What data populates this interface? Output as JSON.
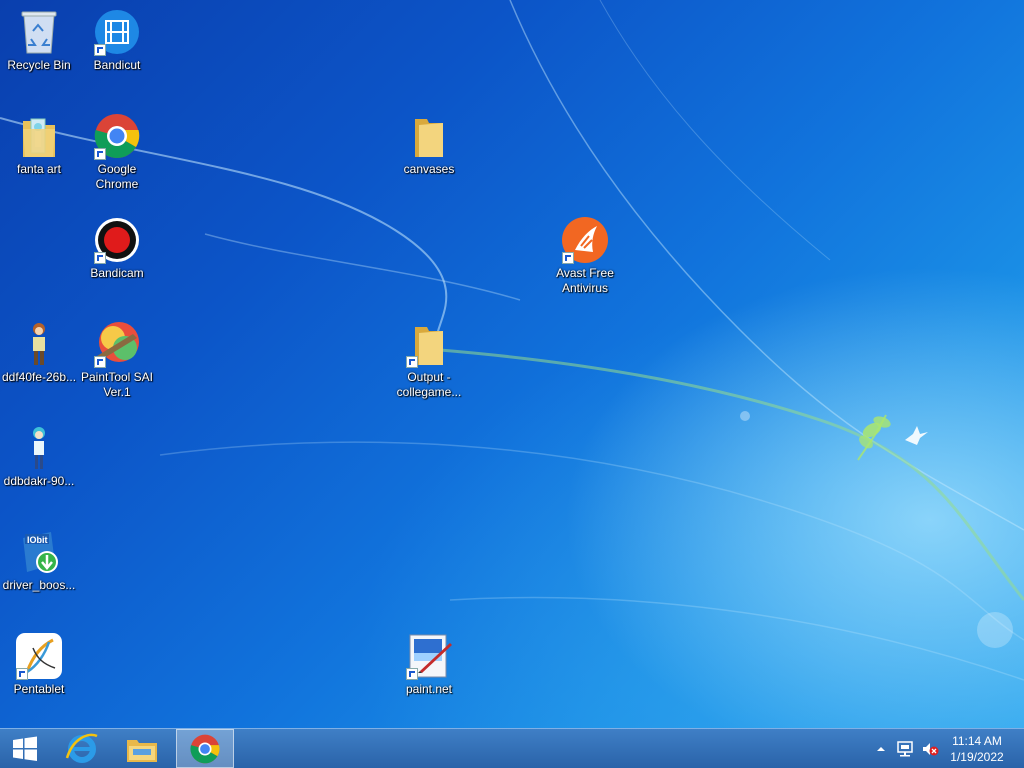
{
  "desktop": {
    "icons": [
      {
        "id": "recycle-bin",
        "label": "Recycle Bin",
        "icon": "recycle-bin-icon"
      },
      {
        "id": "bandicut",
        "label": "Bandicut",
        "icon": "film-icon"
      },
      {
        "id": "fanta-art",
        "label": "fanta art",
        "icon": "folder-icon"
      },
      {
        "id": "google-chrome",
        "label": "Google Chrome",
        "icon": "chrome-icon"
      },
      {
        "id": "canvases",
        "label": "canvases",
        "icon": "folder-icon"
      },
      {
        "id": "bandicam",
        "label": "Bandicam",
        "icon": "record-icon"
      },
      {
        "id": "avast",
        "label": "Avast Free Antivirus",
        "icon": "avast-icon"
      },
      {
        "id": "ddf40fe",
        "label": "ddf40fe-26b...",
        "icon": "character-image-icon"
      },
      {
        "id": "painttool-sai",
        "label": "PaintTool SAI Ver.1",
        "icon": "painttool-sai-icon"
      },
      {
        "id": "output-collegame",
        "label": "Output - collegame...",
        "icon": "folder-icon"
      },
      {
        "id": "ddbdakr",
        "label": "ddbdakr-90...",
        "icon": "character-image-icon"
      },
      {
        "id": "driver-booster",
        "label": "driver_boos...",
        "icon": "iobit-installer-icon"
      },
      {
        "id": "pentablet",
        "label": "Pentablet",
        "icon": "pentablet-icon"
      },
      {
        "id": "paint-net",
        "label": "paint.net",
        "icon": "paint-net-icon"
      }
    ]
  },
  "taskbar": {
    "start": {
      "icon": "windows-logo-icon"
    },
    "pinned": [
      {
        "id": "internet-explorer",
        "icon": "internet-explorer-icon"
      },
      {
        "id": "file-explorer",
        "icon": "file-explorer-icon"
      },
      {
        "id": "chrome",
        "icon": "chrome-icon",
        "active": true
      }
    ],
    "tray": {
      "icons": [
        "show-hidden-icons-chevron-icon",
        "network-icon",
        "volume-muted-icon"
      ],
      "time": "11:14 AM",
      "date": "1/19/2022"
    }
  },
  "colors": {
    "desktop_blue": "#1173dc",
    "taskbar": "#2a63a9",
    "chrome_red": "#db4437",
    "chrome_yellow": "#f4c20d",
    "chrome_green": "#0f9d58",
    "chrome_blue": "#4285f4",
    "avast_orange": "#f26722",
    "folder_yellow": "#e8c15a"
  }
}
